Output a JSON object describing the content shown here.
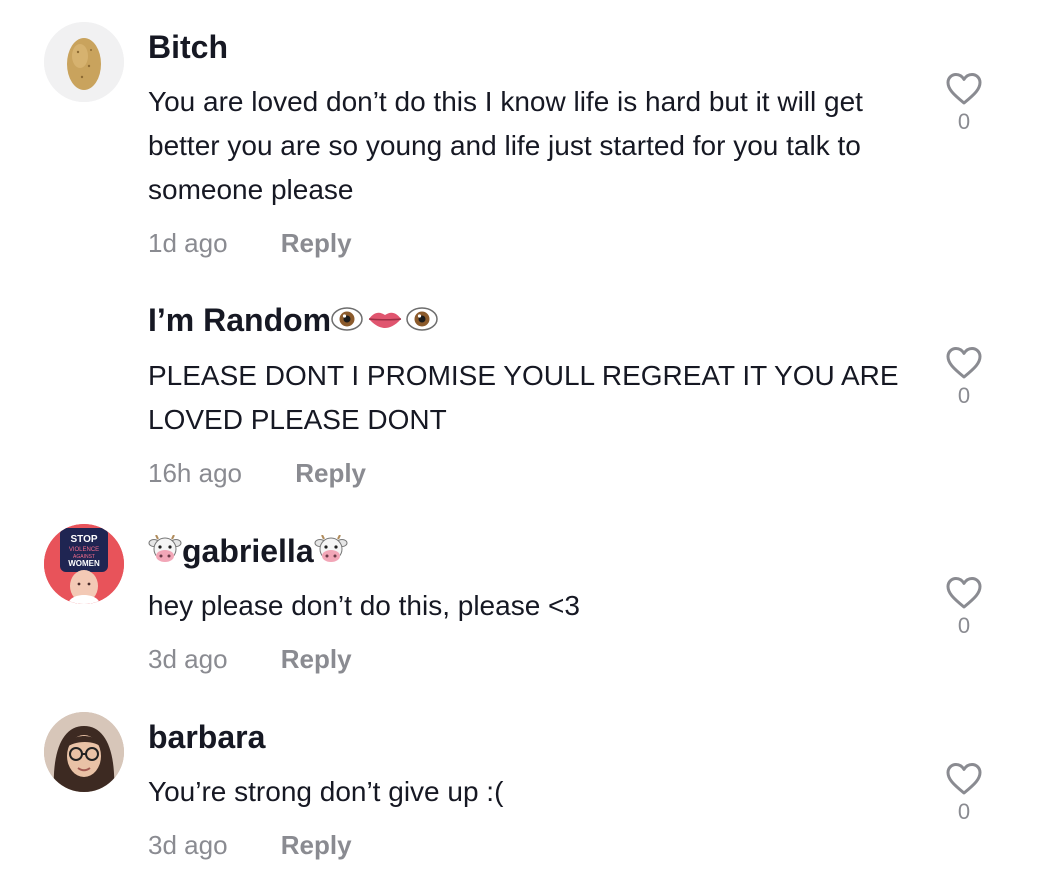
{
  "comments": [
    {
      "username": "Bitch",
      "avatar": "potato-avatar",
      "text": "You are loved don’t do this I know life is hard but it will get better you are so young and life just started for you talk to someone please",
      "time": "1d ago",
      "reply_label": "Reply",
      "likes": "0"
    },
    {
      "username": "I’m Random",
      "username_suffix_emoji": [
        "eye",
        "lips",
        "eye"
      ],
      "text": "PLEASE DONT I PROMISE YOULL REGREAT IT YOU ARE LOVED PLEASE DONT",
      "time": "16h ago",
      "reply_label": "Reply",
      "likes": "0"
    },
    {
      "username": "gabriella",
      "username_wrap_emoji": "cow-face",
      "avatar": "stop-violence-avatar",
      "avatar_text": [
        "STOP",
        "VIOLENCE",
        "AGAINST",
        "WOMEN"
      ],
      "text": "hey please don’t do this, please <3",
      "time": "3d ago",
      "reply_label": "Reply",
      "likes": "0"
    },
    {
      "username": "barbara",
      "avatar": "photo-avatar",
      "text": "You’re strong don’t give up :(",
      "time": "3d ago",
      "reply_label": "Reply",
      "likes": "0"
    }
  ],
  "icons": {
    "like": "heart-outline-icon"
  },
  "colors": {
    "text": "#161823",
    "secondary": "#8a8b91",
    "heart": "#8a8b91"
  }
}
